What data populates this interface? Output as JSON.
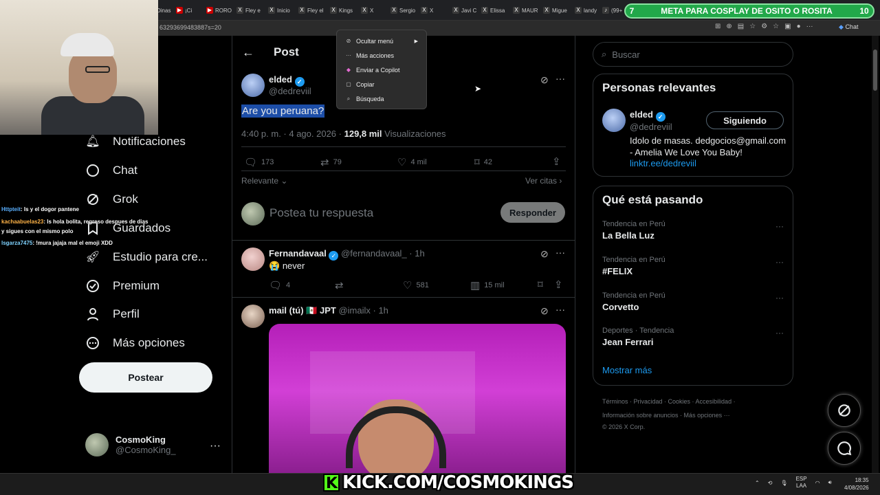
{
  "browser": {
    "tabs": [
      "Dinas",
      "¡Ci",
      "RORO",
      "Fley e",
      "Inicio",
      "Fley el",
      "Kings",
      "X",
      "Sergio",
      "X",
      "Javi C",
      "Elissa",
      "MAUR",
      "Migue",
      "landy",
      "(99+"
    ],
    "url": "63293699483887s=20",
    "chat_label": "Chat"
  },
  "stream_goal": {
    "number": "7",
    "text": "META PARA COSPLAY DE OSITO O ROSITA",
    "count": "10"
  },
  "stream_chat": [
    {
      "user": "Httpteit",
      "text": ": Is y el dogor pantene"
    },
    {
      "user": "kachaabuelas23",
      "text": ": ls hola bolita, regreso despues de dias"
    },
    {
      "user": "",
      "text": "y sigues con el mismo polo"
    },
    {
      "user": "lsgarza7475",
      "text": ": !mura jajaja mal el emoji XDD"
    }
  ],
  "nav": {
    "items": [
      "Notificaciones",
      "Chat",
      "Grok",
      "Guardados",
      "Estudio para cre...",
      "Premium",
      "Perfil",
      "Más opciones"
    ],
    "post_button": "Postear",
    "account_name": "CosmoKing",
    "account_handle": "@CosmoKing_"
  },
  "post": {
    "header": "Post",
    "author": "elded",
    "handle": "@dedreviil",
    "text": "Are you peruana?",
    "time": "4:40 p. m. · 4 ago. 2026 ·",
    "views_count": "129,8 mil",
    "views_label": "Visualizaciones",
    "replies": "173",
    "reposts": "79",
    "likes": "4 mil",
    "bookmarks": "42",
    "sort": "Relevante",
    "quotes_link": "Ver citas",
    "reply_placeholder": "Postea tu respuesta",
    "reply_button": "Responder"
  },
  "context_menu": [
    "Ocultar menú",
    "Más acciones",
    "Enviar a Copilot",
    "Copiar",
    "Búsqueda"
  ],
  "replies": [
    {
      "name": "Fernandavaal",
      "handle": "@fernandavaal_ · 1h",
      "text": "never",
      "emoji": "😭",
      "replies": "4",
      "likes": "581",
      "views": "15 mil"
    },
    {
      "name": "mail (tú)",
      "flag": "🇲🇽",
      "extra": "JPT",
      "handle": "@imailx · 1h"
    }
  ],
  "right": {
    "search_placeholder": "Buscar",
    "relevant_title": "Personas relevantes",
    "relevant_name": "elded",
    "relevant_handle": "@dedreviil",
    "follow_button": "Siguiendo",
    "bio": "Idolo de masas. dedgocios@gmail.com - Amelia We Love You Baby!",
    "bio_link": "linktr.ee/dedreviil",
    "trends_title": "Qué está pasando",
    "trends": [
      {
        "context": "Tendencia en Perú",
        "title": "La Bella Luz"
      },
      {
        "context": "Tendencia en Perú",
        "title": "#FELIX"
      },
      {
        "context": "Tendencia en Perú",
        "title": "Corvetto"
      },
      {
        "context": "Deportes · Tendencia",
        "title": "Jean Ferrari"
      }
    ],
    "show_more": "Mostrar más",
    "footer_line1": "Términos · Privacidad · Cookies · Accesibilidad ·",
    "footer_line2": "Información sobre anuncios · Más opciones ···",
    "footer_line3": "© 2026 X Corp."
  },
  "taskbar": {
    "kick": "KICK.COM/COSMOKINGS",
    "kick_logo": "K",
    "lang1": "ESP",
    "lang2": "LAA",
    "time": "18:35",
    "date": "4/08/2026"
  },
  "colors": {
    "accent": "#1d9bf0",
    "goal": "#22a84a",
    "kick": "#53fc18",
    "selection": "#1d4ea8"
  }
}
